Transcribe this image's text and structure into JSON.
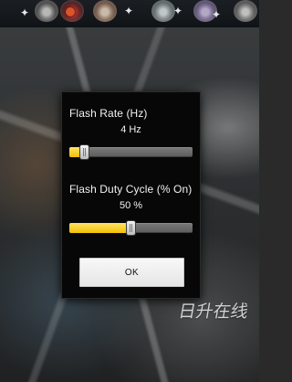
{
  "top_bar": {
    "icons": [
      "app-icon-1",
      "app-icon-2",
      "app-icon-3",
      "app-icon-4",
      "app-icon-5",
      "app-icon-6"
    ]
  },
  "dialog": {
    "flash_rate": {
      "label": "Flash Rate (Hz)",
      "value_text": "4 Hz",
      "slider_fraction": 0.12
    },
    "duty_cycle": {
      "label": "Flash Duty Cycle (% On)",
      "value_text": "50 %",
      "slider_fraction": 0.5
    },
    "ok_button_label": "OK"
  },
  "watermark_text": "日升在线",
  "colors": {
    "dialog_bg": "#070707",
    "slider_fill": "#f2c000",
    "track": "#6a6a6a"
  }
}
